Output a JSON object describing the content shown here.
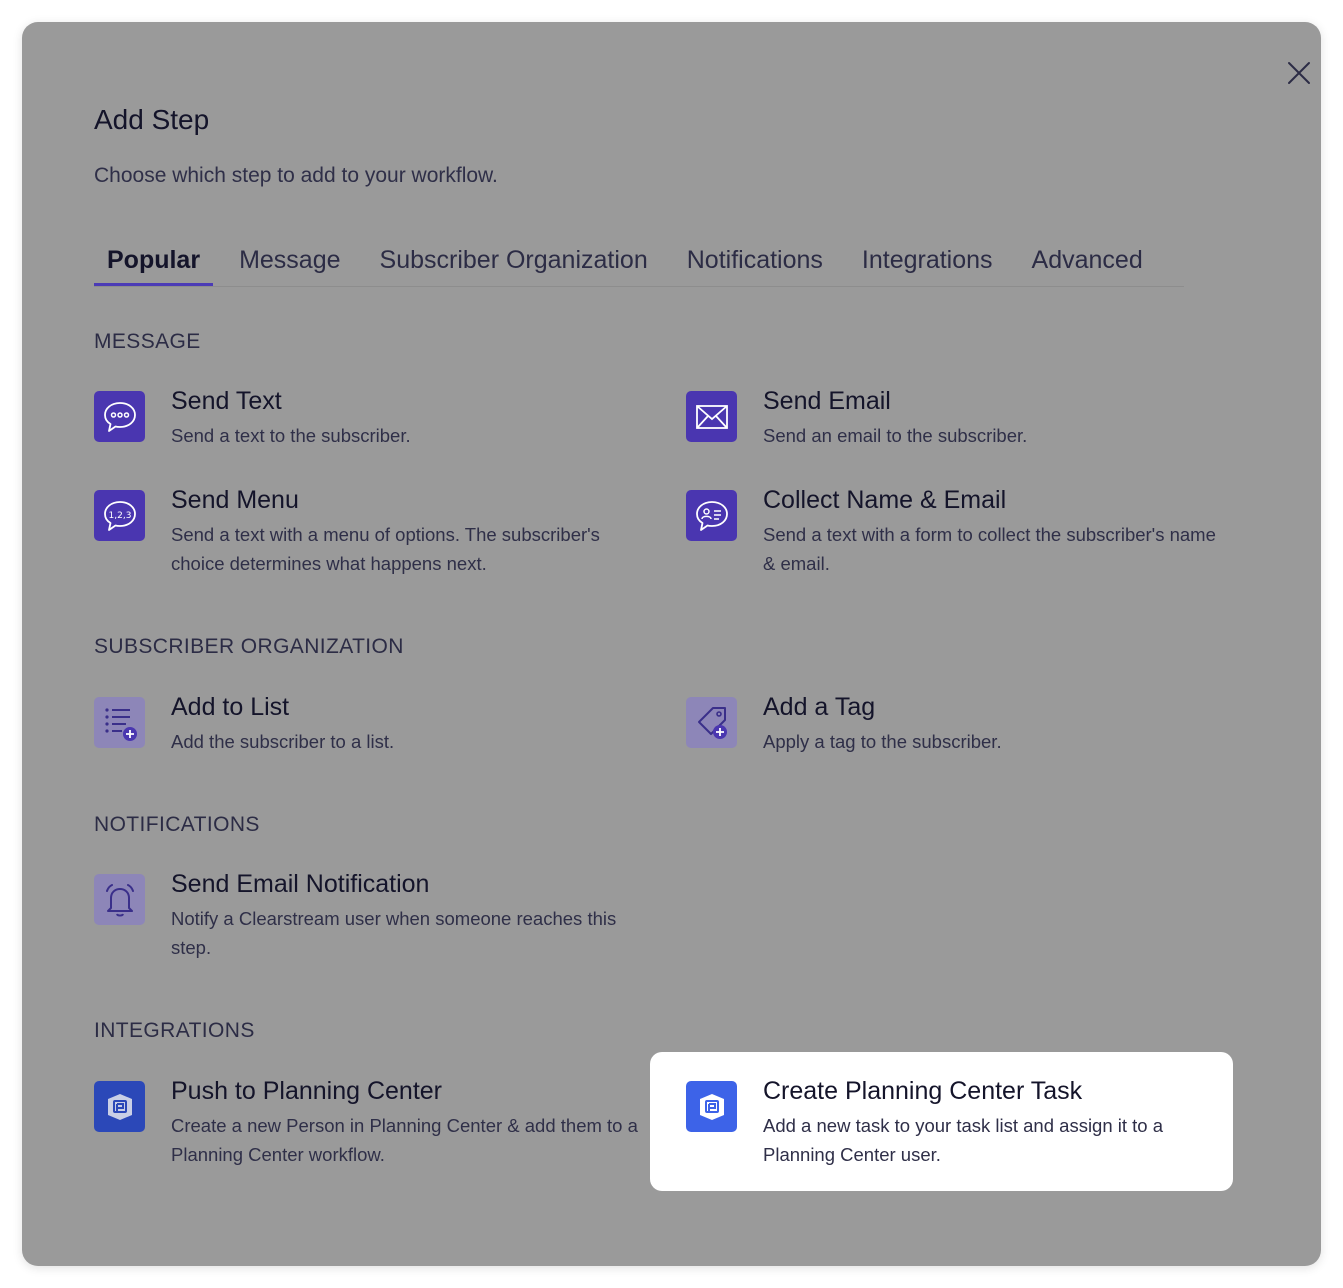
{
  "modal": {
    "title": "Add Step",
    "subtitle": "Choose which step to add to your workflow."
  },
  "tabs": [
    {
      "label": "Popular",
      "active": true
    },
    {
      "label": "Message",
      "active": false
    },
    {
      "label": "Subscriber Organization",
      "active": false
    },
    {
      "label": "Notifications",
      "active": false
    },
    {
      "label": "Integrations",
      "active": false
    },
    {
      "label": "Advanced",
      "active": false
    }
  ],
  "sections": {
    "message": {
      "heading": "MESSAGE",
      "items": [
        {
          "name": "Send Text",
          "desc": "Send a text to the subscriber.",
          "icon": "chat-dots-icon"
        },
        {
          "name": "Send Email",
          "desc": "Send an email to the subscriber.",
          "icon": "envelope-icon"
        },
        {
          "name": "Send Menu",
          "desc": "Send a text with a menu of options. The subscriber's choice determines what happens next.",
          "icon": "chat-numbers-icon"
        },
        {
          "name": "Collect Name & Email",
          "desc": "Send a text with a form to collect the subscriber's name & email.",
          "icon": "chat-contact-icon"
        }
      ]
    },
    "subscriber_organization": {
      "heading": "SUBSCRIBER ORGANIZATION",
      "items": [
        {
          "name": "Add to List",
          "desc": "Add the subscriber to a list.",
          "icon": "list-add-icon"
        },
        {
          "name": "Add a Tag",
          "desc": "Apply a tag to the subscriber.",
          "icon": "tag-add-icon"
        }
      ]
    },
    "notifications": {
      "heading": "NOTIFICATIONS",
      "items": [
        {
          "name": "Send Email Notification",
          "desc": "Notify a Clearstream user when someone reaches this step.",
          "icon": "bell-icon"
        }
      ]
    },
    "integrations": {
      "heading": "INTEGRATIONS",
      "items": [
        {
          "name": "Push to Planning Center",
          "desc": "Create a new Person in Planning Center & add them to a Planning Center workflow.",
          "icon": "planning-center-icon"
        },
        {
          "name": "Create Planning Center Task",
          "desc": "Add a new task to your task list and assign it to a Planning Center user.",
          "icon": "planning-center-icon",
          "highlighted": true
        }
      ]
    }
  },
  "colors": {
    "overlay_gray": "#9a9a9a",
    "accent_purple": "#4a36b0",
    "planning_center_blue": "#3d63e8"
  }
}
